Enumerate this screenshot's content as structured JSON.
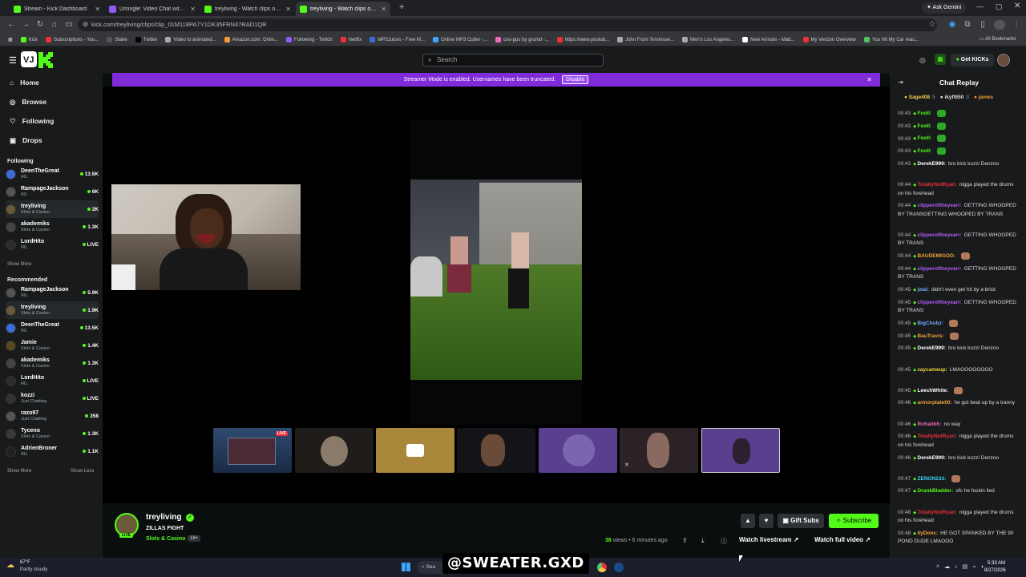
{
  "browser": {
    "tabs": [
      {
        "label": "Stream - Kick Dashboard",
        "active": false
      },
      {
        "label": "Umingle: Video Chat with S",
        "active": false
      },
      {
        "label": "treyliving - Watch clips on Kick",
        "active": false
      },
      {
        "label": "treyliving - Watch clips on K",
        "active": true
      }
    ],
    "gemini": "Ask Gemini",
    "url": "kick.com/treyliving/clips/clip_01M118PA7Y1DK35FRN47RAD1QR",
    "bookmarks": [
      "Kick",
      "Subscriptions - You...",
      "Stake",
      "Twitter",
      "Video to animated...",
      "Amazon.com: Onlin...",
      "Following - Twitch",
      "Netflix",
      "MP3Juices - Free M...",
      "Online MP3 Cutter -...",
      "osu-pps by grumd -...",
      "https://www.youtub...",
      "John From Tennesse...",
      "Men's Los Angeles...",
      "New Arrivals - Mad...",
      "My Verizon Overview",
      "You Hit My Car reac..."
    ],
    "all_bookmarks": "All Bookmarks"
  },
  "kick": {
    "search_placeholder": "Search",
    "get_kicks": "Get KICKs",
    "nav": [
      "Home",
      "Browse",
      "Following",
      "Drops"
    ],
    "following_title": "Following",
    "following": [
      {
        "name": "DeenTheGreat",
        "cat": "IRL",
        "viewers": "13.5K",
        "color": "#3a6bd6"
      },
      {
        "name": "RampageJackson",
        "cat": "IRL",
        "viewers": "6K",
        "color": "#555"
      },
      {
        "name": "treyliving",
        "cat": "Slots & Casino",
        "viewers": "2K",
        "color": "#6a5a3a"
      },
      {
        "name": "akademiks",
        "cat": "Slots & Casino",
        "viewers": "1.3K",
        "color": "#444"
      },
      {
        "name": "LordHito",
        "cat": "IRL",
        "viewers": "LIVE",
        "color": "#2b2b2b"
      }
    ],
    "show_more": "Show More",
    "show_less": "Show Less",
    "recommended_title": "Recommended",
    "recommended": [
      {
        "name": "RampageJackson",
        "cat": "IRL",
        "viewers": "5.9K",
        "color": "#555"
      },
      {
        "name": "treyliving",
        "cat": "Slots & Casino",
        "viewers": "1.9K",
        "color": "#6a5a3a"
      },
      {
        "name": "DeenTheGreat",
        "cat": "IRL",
        "viewers": "13.5K",
        "color": "#3a6bd6"
      },
      {
        "name": "Jamie",
        "cat": "Slots & Casino",
        "viewers": "1.4K",
        "color": "#5a4a20"
      },
      {
        "name": "akademiks",
        "cat": "Slots & Casino",
        "viewers": "1.3K",
        "color": "#444"
      },
      {
        "name": "LordHito",
        "cat": "IRL",
        "viewers": "LIVE",
        "color": "#2b2b2b"
      },
      {
        "name": "kozzi",
        "cat": "Just Chatting",
        "viewers": "LIVE",
        "color": "#333"
      },
      {
        "name": "razo97",
        "cat": "Just Chatting",
        "viewers": "358",
        "color": "#555"
      },
      {
        "name": "Tyceno",
        "cat": "Slots & Casino",
        "viewers": "1.3K",
        "color": "#3a3a3a"
      },
      {
        "name": "AdrienBroner",
        "cat": "IRL",
        "viewers": "1.1K",
        "color": "#222"
      }
    ],
    "banner_text": "Streamer Mode is enabled. Usernames have been truncated.",
    "banner_button": "Disable",
    "live_badge": "LIVE",
    "channel": {
      "name": "treyliving",
      "title": "ZILLAS FIGHT",
      "category": "Slots & Casino",
      "age": "18+",
      "views": "38",
      "views_label": "views",
      "time": "6 minutes ago",
      "live": "LIVE",
      "gift_subs": "Gift Subs",
      "subscribe": "Subscribe",
      "watch_livestream": "Watch livestream",
      "watch_full": "Watch full video"
    },
    "chat": {
      "title": "Chat Replay",
      "top": [
        {
          "name": "Sage408",
          "n": "5"
        },
        {
          "name": "ikyfl850",
          "n": "3"
        },
        {
          "name": "james",
          "n": ""
        }
      ],
      "messages": [
        {
          "t": "00:43",
          "u": "Fooll:",
          "m": "",
          "c": "#53fc18",
          "lines": 1
        },
        {
          "t": "00:43",
          "u": "Fooll:",
          "m": "",
          "c": "#53fc18",
          "lines": 1
        },
        {
          "t": "00:43",
          "u": "Fooll:",
          "m": "",
          "c": "#53fc18",
          "lines": 1
        },
        {
          "t": "00:43",
          "u": "Fooll:",
          "m": "",
          "c": "#53fc18",
          "lines": 1
        },
        {
          "t": "00:43",
          "u": "DerekE999:",
          "m": "bro kick kozzi Denzoo",
          "c": "#ffffff",
          "lines": 2
        },
        {
          "t": "00:44",
          "u": "TotallyNotRyan:",
          "m": "nigga played the drums on his forehead",
          "c": "#e9303b",
          "lines": 2
        },
        {
          "t": "00:44",
          "u": "clipperoftheyearr:",
          "m": "GETTING WHOOPED BY TRANSGETTING WHOOPED BY TRANS",
          "c": "#b55cf5",
          "lines": 3
        },
        {
          "t": "00:44",
          "u": "clipperoftheyearr:",
          "m": "GETTING WHOOPED BY TRANS",
          "c": "#b55cf5",
          "lines": 2
        },
        {
          "t": "00:44",
          "u": "BAUDEMIGOD:",
          "m": "",
          "c": "#f2a33a",
          "lines": 1
        },
        {
          "t": "00:44",
          "u": "clipperoftheyearr:",
          "m": "GETTING WHOOPED BY TRANS",
          "c": "#b55cf5",
          "lines": 2
        },
        {
          "t": "00:45",
          "u": "jwal:",
          "m": "didn't even get hit by a brick",
          "c": "#7aa7ff",
          "lines": 1
        },
        {
          "t": "00:45",
          "u": "clipperoftheyearr:",
          "m": "GETTING WHOOPED BY TRANS",
          "c": "#b55cf5",
          "lines": 2
        },
        {
          "t": "00:45",
          "u": "BigChubz:",
          "m": "",
          "c": "#7aa7ff",
          "lines": 1
        },
        {
          "t": "00:45",
          "u": "BauTravis:",
          "m": "",
          "c": "#f2a33a",
          "lines": 1
        },
        {
          "t": "00:45",
          "u": "DerekE999:",
          "m": "bro kick kozzi Denzoo",
          "c": "#ffffff",
          "lines": 2
        },
        {
          "t": "00:45",
          "u": "zaycameup:",
          "m": "LMAOOOOOOOO",
          "c": "#f2d33a",
          "lines": 2
        },
        {
          "t": "00:45",
          "u": "LeechWhite:",
          "m": "",
          "c": "#ffffff",
          "lines": 1
        },
        {
          "t": "00:46",
          "u": "armorplate00:",
          "m": "he got beat up by a tranny",
          "c": "#f2a33a",
          "lines": 2
        },
        {
          "t": "00:46",
          "u": "Rohaiibh:",
          "m": "no way",
          "c": "#f26ab6",
          "lines": 1
        },
        {
          "t": "00:46",
          "u": "TotallyNotRyan:",
          "m": "nigga played the drums on his forehead",
          "c": "#e9303b",
          "lines": 2
        },
        {
          "t": "00:46",
          "u": "DerekE999:",
          "m": "bro kick kozzi Denzoo",
          "c": "#ffffff",
          "lines": 2
        },
        {
          "t": "00:47",
          "u": "ZENON233:",
          "m": "",
          "c": "#3ad3f2",
          "lines": 1
        },
        {
          "t": "00:47",
          "u": "DrankBladder:",
          "m": "ofc he fuckin lied",
          "c": "#53fc18",
          "lines": 2
        },
        {
          "t": "00:48",
          "u": "TotallyNotRyan:",
          "m": "nigga played the drums on his forehead",
          "c": "#e9303b",
          "lines": 2
        },
        {
          "t": "00:48",
          "u": "IlyDonc:",
          "m": "HE GOT SPANKED BY THE 90 POND DUDE LMAOOO",
          "c": "#f2a33a",
          "lines": 2
        }
      ]
    }
  },
  "taskbar": {
    "temp": "67°F",
    "weather": "Partly cloudy",
    "search": "Sea",
    "watermark": "@SWEATER.GXD",
    "time": "5:33 AM",
    "date": "8/27/2026"
  }
}
